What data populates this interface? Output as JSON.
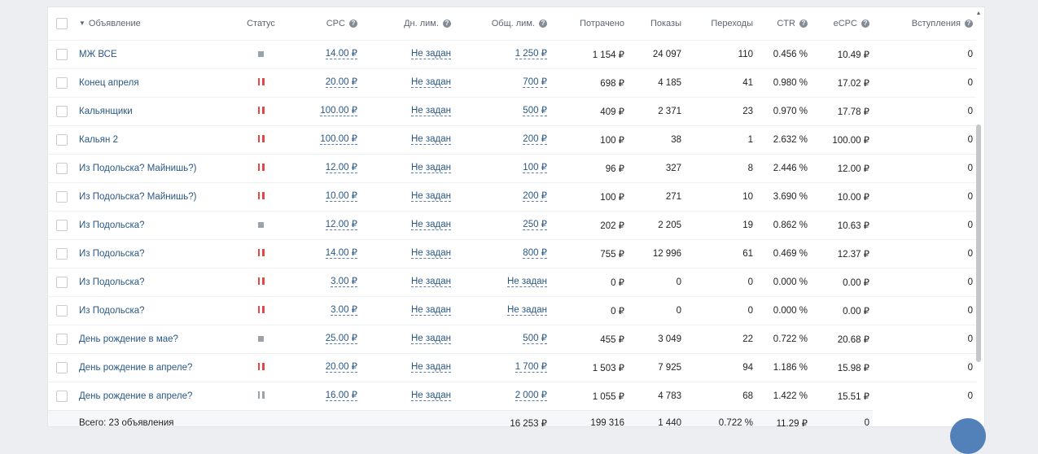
{
  "columns": {
    "name": "Объявление",
    "status": "Статус",
    "cpc": "CPC",
    "day_limit": "Дн. лим.",
    "total_limit": "Общ. лим.",
    "spent": "Потрачено",
    "impressions": "Показы",
    "clicks": "Переходы",
    "ctr": "CTR",
    "ecpc": "eCPC",
    "joins": "Вступления"
  },
  "rows": [
    {
      "name": "МЖ ВСЕ",
      "status": "stopped",
      "cpc": "14.00 ₽",
      "day_limit": "Не задан",
      "total_limit": "1 250 ₽",
      "spent": "1 154 ₽",
      "impressions": "24 097",
      "clicks": "110",
      "ctr": "0.456 %",
      "ecpc": "10.49 ₽",
      "joins": "0"
    },
    {
      "name": "Конец апреля",
      "status": "paused",
      "cpc": "20.00 ₽",
      "day_limit": "Не задан",
      "total_limit": "700 ₽",
      "spent": "698 ₽",
      "impressions": "4 185",
      "clicks": "41",
      "ctr": "0.980 %",
      "ecpc": "17.02 ₽",
      "joins": "0"
    },
    {
      "name": "Кальянщики",
      "status": "paused",
      "cpc": "100.00 ₽",
      "day_limit": "Не задан",
      "total_limit": "500 ₽",
      "spent": "409 ₽",
      "impressions": "2 371",
      "clicks": "23",
      "ctr": "0.970 %",
      "ecpc": "17.78 ₽",
      "joins": "0"
    },
    {
      "name": "Кальян 2",
      "status": "paused",
      "cpc": "100.00 ₽",
      "day_limit": "Не задан",
      "total_limit": "200 ₽",
      "spent": "100 ₽",
      "impressions": "38",
      "clicks": "1",
      "ctr": "2.632 %",
      "ecpc": "100.00 ₽",
      "joins": "0"
    },
    {
      "name": "Из Подольска? Майнишь?)",
      "status": "paused",
      "cpc": "12.00 ₽",
      "day_limit": "Не задан",
      "total_limit": "100 ₽",
      "spent": "96 ₽",
      "impressions": "327",
      "clicks": "8",
      "ctr": "2.446 %",
      "ecpc": "12.00 ₽",
      "joins": "0"
    },
    {
      "name": "Из Подольска? Майнишь?)",
      "status": "paused",
      "cpc": "10.00 ₽",
      "day_limit": "Не задан",
      "total_limit": "200 ₽",
      "spent": "100 ₽",
      "impressions": "271",
      "clicks": "10",
      "ctr": "3.690 %",
      "ecpc": "10.00 ₽",
      "joins": "0"
    },
    {
      "name": "Из Подольска?",
      "status": "stopped",
      "cpc": "12.00 ₽",
      "day_limit": "Не задан",
      "total_limit": "250 ₽",
      "spent": "202 ₽",
      "impressions": "2 205",
      "clicks": "19",
      "ctr": "0.862 %",
      "ecpc": "10.63 ₽",
      "joins": "0"
    },
    {
      "name": "Из Подольска?",
      "status": "paused",
      "cpc": "14.00 ₽",
      "day_limit": "Не задан",
      "total_limit": "800 ₽",
      "spent": "755 ₽",
      "impressions": "12 996",
      "clicks": "61",
      "ctr": "0.469 %",
      "ecpc": "12.37 ₽",
      "joins": "0"
    },
    {
      "name": "Из Подольска?",
      "status": "paused",
      "cpc": "3.00 ₽",
      "day_limit": "Не задан",
      "total_limit": "Не задан",
      "spent": "0 ₽",
      "impressions": "0",
      "clicks": "0",
      "ctr": "0.000 %",
      "ecpc": "0.00 ₽",
      "joins": "0"
    },
    {
      "name": "Из Подольска?",
      "status": "paused",
      "cpc": "3.00 ₽",
      "day_limit": "Не задан",
      "total_limit": "Не задан",
      "spent": "0 ₽",
      "impressions": "0",
      "clicks": "0",
      "ctr": "0.000 %",
      "ecpc": "0.00 ₽",
      "joins": "0"
    },
    {
      "name": "День рождение в мае?",
      "status": "stopped",
      "cpc": "25.00 ₽",
      "day_limit": "Не задан",
      "total_limit": "500 ₽",
      "spent": "455 ₽",
      "impressions": "3 049",
      "clicks": "22",
      "ctr": "0.722 %",
      "ecpc": "20.68 ₽",
      "joins": "0"
    },
    {
      "name": "День рождение в апреле?",
      "status": "paused",
      "cpc": "20.00 ₽",
      "day_limit": "Не задан",
      "total_limit": "1 700 ₽",
      "spent": "1 503 ₽",
      "impressions": "7 925",
      "clicks": "94",
      "ctr": "1.186 %",
      "ecpc": "15.98 ₽",
      "joins": "0"
    },
    {
      "name": "День рождение в апреле?",
      "status": "paused-gray",
      "cpc": "16.00 ₽",
      "day_limit": "Не задан",
      "total_limit": "2 000 ₽",
      "spent": "1 055 ₽",
      "impressions": "4 783",
      "clicks": "68",
      "ctr": "1.422 %",
      "ecpc": "15.51 ₽",
      "joins": "0"
    }
  ],
  "total": {
    "label": "Всего: 23 объявления",
    "spent": "16 253 ₽",
    "impressions": "199 316",
    "clicks": "1 440",
    "ctr": "0.722 %",
    "ecpc": "11.29 ₽",
    "joins": "0"
  },
  "icons": {
    "help": "question-circle-icon",
    "sort": "triangle-down-icon"
  },
  "colors": {
    "link": "#2a5885",
    "paused": "#e64646",
    "stopped": "#9aa2ab",
    "fab": "#5181b8"
  }
}
